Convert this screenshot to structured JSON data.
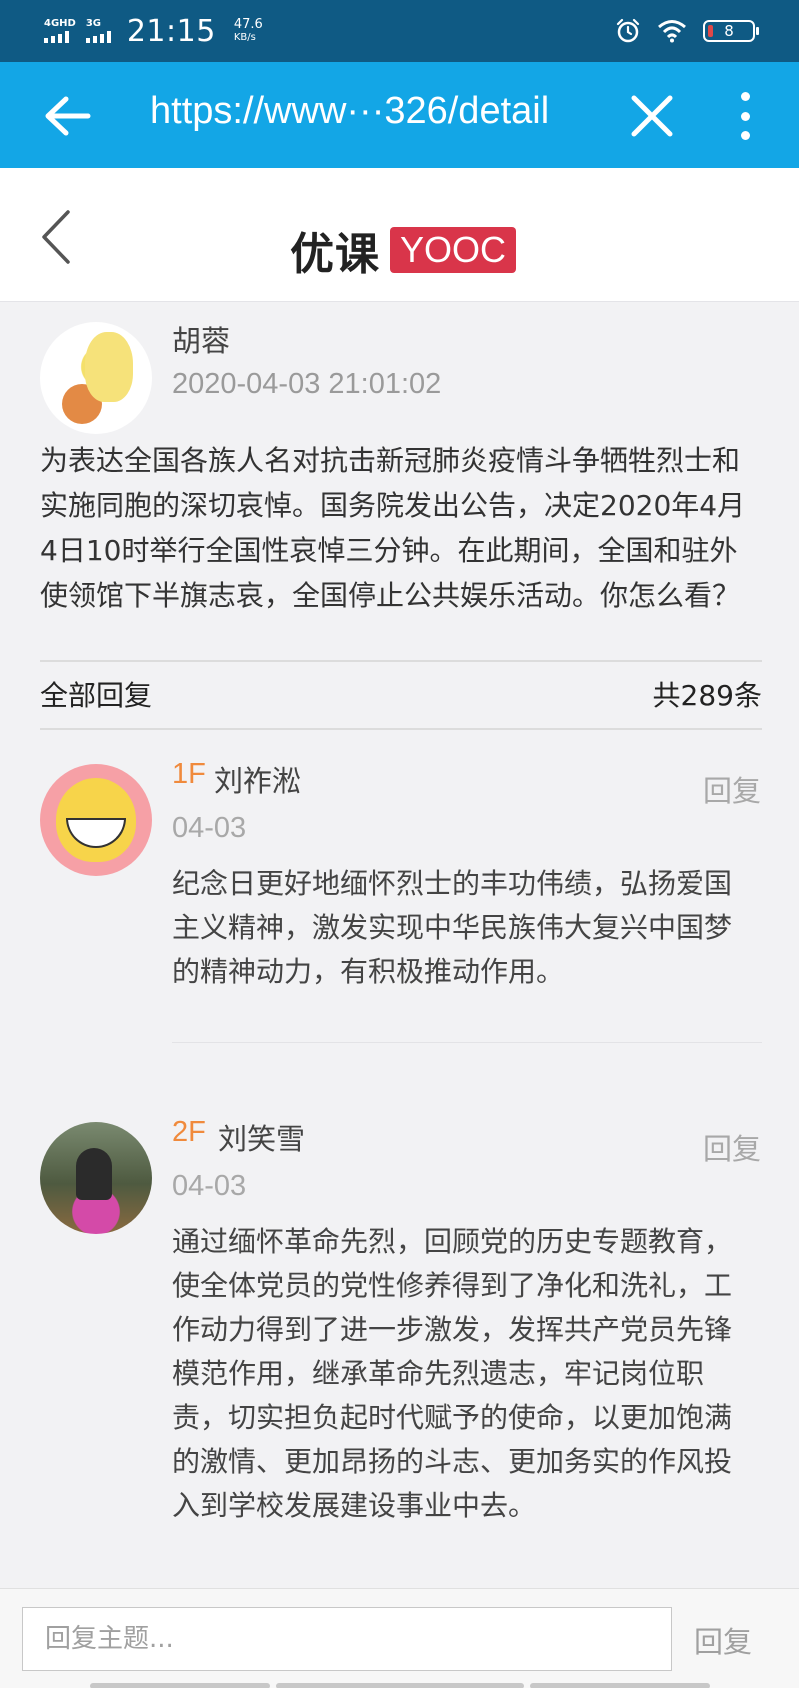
{
  "status_bar": {
    "network_left": "4GHD",
    "network_right": "3G",
    "time": "21:15",
    "speed_value": "47.6",
    "speed_unit": "KB/s",
    "battery": "8",
    "icons": [
      "signal-icon",
      "alarm-icon",
      "wifi-icon",
      "battery-icon"
    ]
  },
  "browser": {
    "url": "https://www···326/detail",
    "icons": [
      "back-arrow-icon",
      "close-icon",
      "more-vertical-icon"
    ]
  },
  "app_header": {
    "logo_cn": "优课",
    "logo_en": "YOOC",
    "brand_color": "#d9354a"
  },
  "post": {
    "author": "胡蓉",
    "datetime": "2020-04-03 21:01:02",
    "body": "为表达全国各族人名对抗击新冠肺炎疫情斗争牺牲烈士和实施同胞的深切哀悼。国务院发出公告，决定2020年4月4日10时举行全国性哀悼三分钟。在此期间，全国和驻外使领馆下半旗志哀，全国停止公共娱乐活动。你怎么看？"
  },
  "replies_header": {
    "label": "全部回复",
    "count": "共289条"
  },
  "replies": [
    {
      "floor": "1F",
      "author": "刘祚淞",
      "date": "04-03",
      "action": "回复",
      "body": "纪念日更好地缅怀烈士的丰功伟绩，弘扬爱国主义精神，激发实现中华民族伟大复兴中国梦的精神动力，有积极推动作用。"
    },
    {
      "floor": "2F",
      "author": "刘笑雪",
      "date": "04-03",
      "action": "回复",
      "body": "通过缅怀革命先烈，回顾党的历史专题教育，使全体党员的党性修养得到了净化和洗礼，工作动力得到了进一步激发，发挥共产党员先锋模范作用，继承革命先烈遗志，牢记岗位职责，切实担负起时代赋予的使命，以更加饱满的激情、更加昂扬的斗志、更加务实的作风投入到学校发展建设事业中去。"
    }
  ],
  "reply_box": {
    "placeholder": "回复主题...",
    "send_label": "回复"
  },
  "colors": {
    "status_bar": "#0f5a84",
    "browser_bar": "#13a6e6",
    "floor_accent": "#f08a3c"
  }
}
